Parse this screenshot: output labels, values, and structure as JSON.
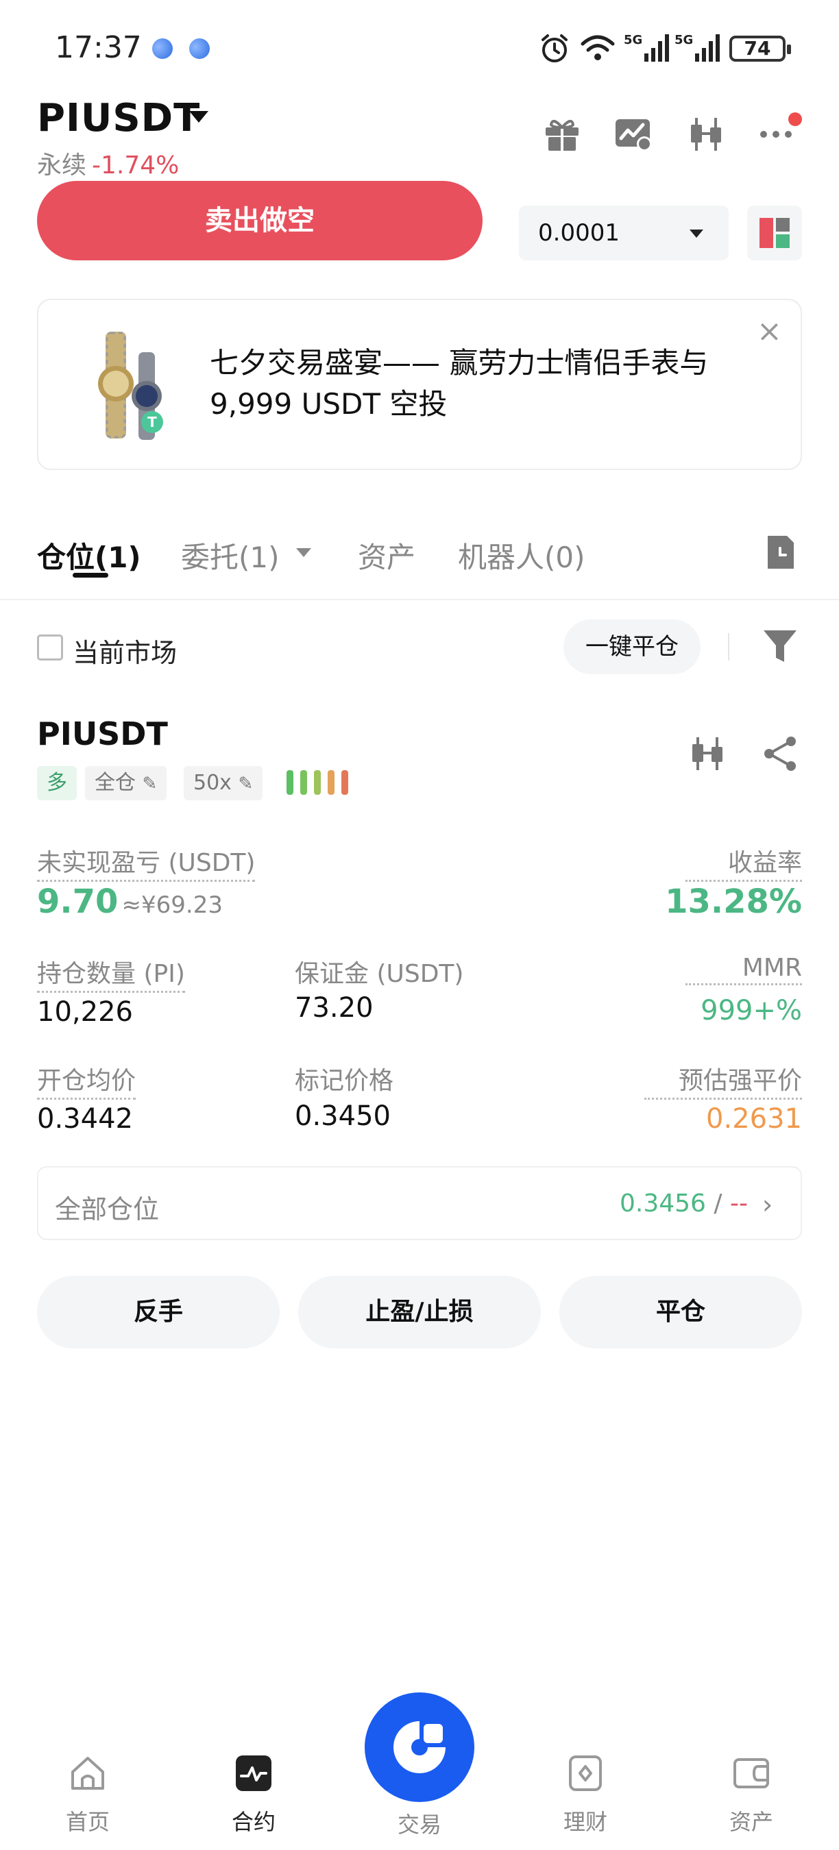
{
  "status_bar": {
    "time": "17:37",
    "battery": "74"
  },
  "header": {
    "pair": "PIUSDT",
    "type": "永续",
    "change": "-1.74%"
  },
  "trade": {
    "sell_label": "卖出做空",
    "qty_value": "0.0001"
  },
  "banner": {
    "text": "七夕交易盛宴—— 赢劳力士情侣手表与 9,999 USDT 空投",
    "close": "×"
  },
  "tabs": [
    {
      "label": "仓位",
      "count": "(1)"
    },
    {
      "label": "委托",
      "count": "(1)"
    },
    {
      "label": "资产",
      "count": ""
    },
    {
      "label": "机器人",
      "count": "(0)"
    }
  ],
  "filter": {
    "current_market": "当前市场",
    "close_all": "一键平仓"
  },
  "position": {
    "pair": "PIUSDT",
    "side": "多",
    "margin_mode": "全仓",
    "leverage": "50x",
    "unrealized_label": "未实现盈亏 (USDT)",
    "unrealized_value": "9.70",
    "unrealized_cny": "≈¥69.23",
    "roe_label": "收益率",
    "roe_value": "13.28%",
    "size_label": "持仓数量 (PI)",
    "size_value": "10,226",
    "margin_label": "保证金 (USDT)",
    "margin_value": "73.20",
    "mmr_label": "MMR",
    "mmr_value": "999+%",
    "entry_label": "开仓均价",
    "entry_value": "0.3442",
    "mark_label": "标记价格",
    "mark_value": "0.3450",
    "liq_label": "预估强平价",
    "liq_value": "0.2631",
    "all_positions_label": "全部仓位",
    "all_positions_price": "0.3456",
    "all_positions_sep": " / ",
    "all_positions_pnl": "--"
  },
  "actions": {
    "reverse": "反手",
    "tpsl": "止盈/止损",
    "close": "平仓"
  },
  "bottom_nav": {
    "home": "首页",
    "futures": "合约",
    "trade": "交易",
    "earn": "理财",
    "assets": "资产"
  },
  "colors": {
    "sell": "#e8505d",
    "green": "#4cb784",
    "red": "#e0505f",
    "orange": "#ef9a4e",
    "fab": "#1a5cf0"
  }
}
